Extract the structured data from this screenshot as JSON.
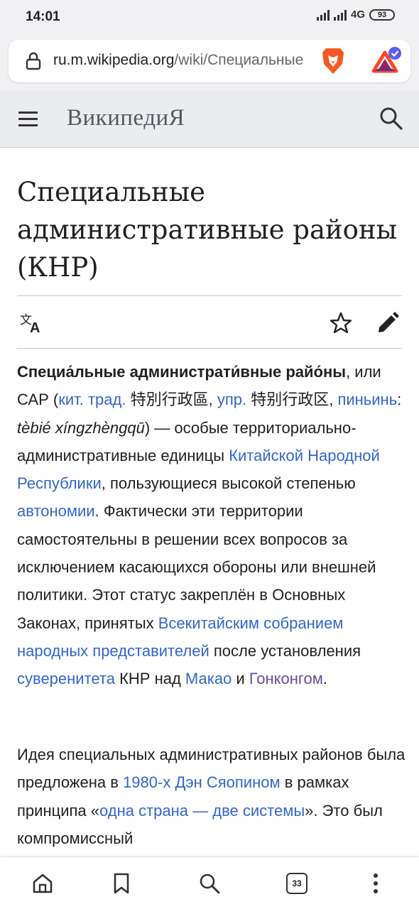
{
  "status_bar": {
    "time": "14:01",
    "network": "4G",
    "battery": "93"
  },
  "browser": {
    "url_host": "ru.m.wikipedia.org",
    "url_path": "/wiki/Специальные",
    "icons": [
      "lock-icon",
      "brave-lion-icon",
      "bat-rewards-icon"
    ]
  },
  "wiki_header": {
    "logo": "ВикипедиЯ",
    "icons": [
      "menu-icon",
      "search-icon"
    ]
  },
  "article": {
    "title": "Специальные административные районы (КНР)",
    "actions": [
      "language-icon",
      "watch-star-icon",
      "edit-pencil-icon"
    ],
    "p1": {
      "bold": "Специа́льные администрати́вные райо́ны",
      "t1": ", или САР (",
      "l_trad": "кит. трад.",
      "han_trad": " 特別行政區, ",
      "l_simp": "упр.",
      "han_simp": " 特别行政区,",
      "l_pinyin": "пиньинь",
      "t2": ": ",
      "pinyin": "tèbié xíngzhèngqū",
      "t3": ") — особые территориально-административные единицы ",
      "l_prc": "Китайской Народной Республики",
      "t4": ", пользующиеся высокой степенью ",
      "l_autonomy": "автономии",
      "t5": ". Фактически эти территории самостоятельны в решении всех вопросов за исключением касающихся обороны или внешней политики. Этот статус закреплён в Основных Законах, принятых ",
      "l_npc": "Всекитайским собранием народных представителей",
      "t6": " после установления ",
      "l_sovereignty": "суверенитета",
      "t7": " КНР над ",
      "l_macau": "Макао",
      "t8": " и ",
      "l_hongkong": "Гонконгом",
      "t9": "."
    },
    "p2": {
      "t1": "Идея специальных административных районов была предложена в ",
      "l_1980s": "1980-х",
      "t2": " ",
      "l_deng": "Дэн Сяопином",
      "t3": " в рамках принципа «",
      "l_octs": "одна страна — две системы",
      "t4": "». Это был компромиссный"
    }
  },
  "bottom_nav": {
    "tabs_count": "33",
    "icons": [
      "home-icon",
      "bookmark-icon",
      "search-icon",
      "tabs-icon",
      "more-icon"
    ]
  },
  "colors": {
    "link": "#3366cc",
    "visited_link": "#6b4ba1",
    "header_bg": "#eaecf0",
    "text": "#202122"
  }
}
